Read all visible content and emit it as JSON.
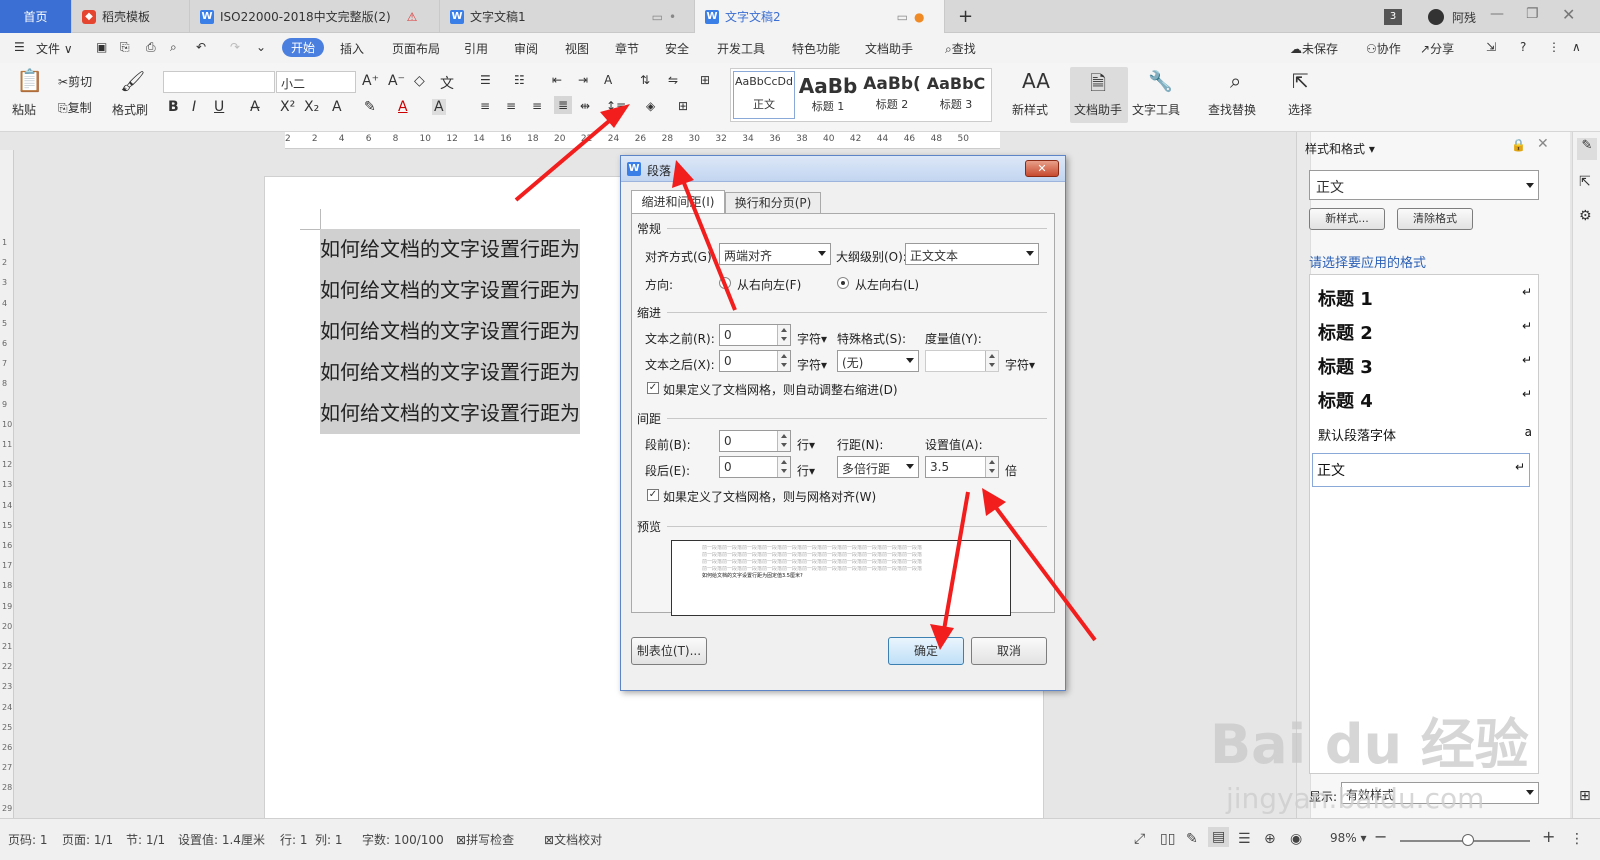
{
  "tabs": [
    {
      "label": "首页"
    },
    {
      "label": "稻壳模板"
    },
    {
      "label": "ISO22000-2018中文完整版(2)"
    },
    {
      "label": "文字文稿1"
    },
    {
      "label": "文字文稿2"
    }
  ],
  "tab_new_label": "+",
  "window": {
    "badge": "3",
    "user": "阿残"
  },
  "menu": {
    "file": "文件",
    "items": [
      "开始",
      "插入",
      "页面布局",
      "引用",
      "审阅",
      "视图",
      "章节",
      "安全",
      "开发工具",
      "特色功能",
      "文档助手"
    ],
    "search": "查找",
    "unsaved": "未保存",
    "collab": "协作",
    "share": "分享"
  },
  "toolbar": {
    "paste": "粘贴",
    "cut": "剪切",
    "copy": "复制",
    "format_painter": "格式刷",
    "font_size": "小二",
    "styles": [
      {
        "sample": "AaBbCcDd",
        "name": "正文"
      },
      {
        "sample": "AaBb",
        "name": "标题 1"
      },
      {
        "sample": "AaBb(",
        "name": "标题 2"
      },
      {
        "sample": "AaBbC",
        "name": "标题 3"
      }
    ],
    "new_style": "新样式",
    "doc_assistant": "文档助手",
    "text_tools": "文字工具",
    "find_replace": "查找替换",
    "select": "选择"
  },
  "ruler_ticks": [
    "2",
    "2",
    "4",
    "6",
    "8",
    "10",
    "12",
    "14",
    "16",
    "18",
    "20",
    "22",
    "24",
    "26",
    "28",
    "30",
    "32",
    "34",
    "36",
    "38",
    "40",
    "42",
    "44",
    "46",
    "48",
    "50"
  ],
  "document": {
    "lines": [
      "如何给文档的文字设置行距为",
      "如何给文档的文字设置行距为",
      "如何给文档的文字设置行距为",
      "如何给文档的文字设置行距为",
      "如何给文档的文字设置行距为"
    ]
  },
  "dialog": {
    "title": "段落",
    "tabs": [
      "缩进和间距(I)",
      "换行和分页(P)"
    ],
    "general": "常规",
    "align_label": "对齐方式(G):",
    "align_value": "两端对齐",
    "outline_label": "大纲级别(O):",
    "outline_value": "正文文本",
    "direction_label": "方向:",
    "rtl": "从右向左(F)",
    "ltr": "从左向右(L)",
    "indent": "缩进",
    "before_text_label": "文本之前(R):",
    "before_text_value": "0",
    "after_text_label": "文本之后(X):",
    "after_text_value": "0",
    "unit_char": "字符",
    "special_label": "特殊格式(S):",
    "special_value": "(无)",
    "measure_label": "度量值(Y):",
    "measure_value": "",
    "grid_indent": "如果定义了文档网格，则自动调整右缩进(D)",
    "spacing": "间距",
    "before_label": "段前(B):",
    "before_value": "0",
    "after_label": "段后(E):",
    "after_value": "0",
    "unit_line": "行",
    "line_spacing_label": "行距(N):",
    "line_spacing_value": "多倍行距",
    "set_value_label": "设置值(A):",
    "set_value": "3.5",
    "unit_times": "倍",
    "grid_align": "如果定义了文档网格，则与网格对齐(W)",
    "preview": "预览",
    "preview_prev": "前一段落前一段落前一段落前一段落前一段落前一段落前一段落前一段落前一段落前一段落前一段落",
    "preview_text": "如何给文档的文字设置行距为固定值3.5厘米?",
    "tabs_button": "制表位(T)...",
    "ok": "确定",
    "cancel": "取消"
  },
  "style_pane": {
    "title": "样式和格式",
    "current": "正文",
    "new_style": "新样式...",
    "clear_format": "清除格式",
    "prompt": "请选择要应用的格式",
    "items": [
      "标题 1",
      "标题 2",
      "标题 3",
      "标题 4"
    ],
    "default_font": "默认段落字体",
    "normal": "正文",
    "show_label": "显示:",
    "show_value": "有效样式"
  },
  "status": {
    "page_num": "页码: 1",
    "pages": "页面: 1/1",
    "section": "节: 1/1",
    "setting": "设置值: 1.4厘米",
    "row": "行: 1",
    "col": "列: 1",
    "words": "字数: 100/100",
    "spell": "拼写检查",
    "proof": "文档校对",
    "zoom": "98%"
  },
  "watermark": {
    "brand": "Bai du 经验",
    "url": "jingyan.baidu.com"
  },
  "colors": {
    "accent": "#3b6fd3",
    "arrow": "#f21d1d"
  }
}
